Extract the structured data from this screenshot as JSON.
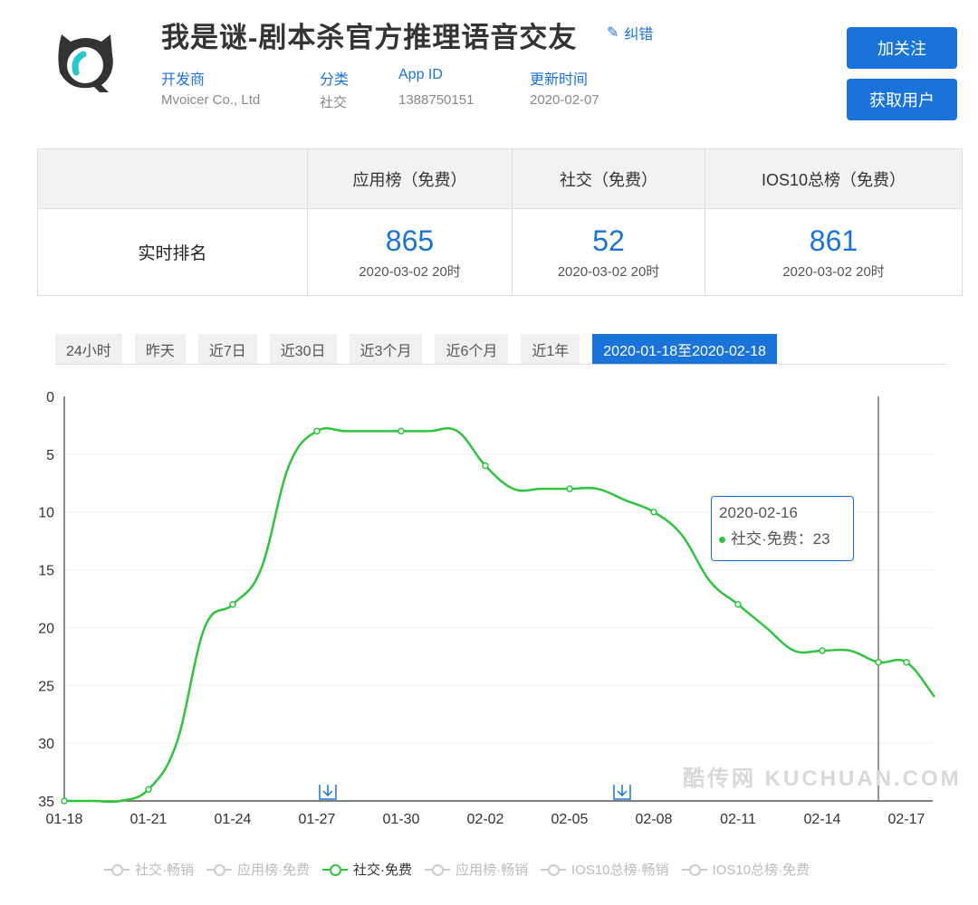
{
  "app": {
    "title": "我是谜-剧本杀官方推理语音交友",
    "fix_label": "纠错",
    "meta": [
      {
        "label": "开发商",
        "value": "Mvoicer Co., Ltd"
      },
      {
        "label": "分类",
        "value": "社交"
      },
      {
        "label": "App ID",
        "value": "1388750151"
      },
      {
        "label": "更新时间",
        "value": "2020-02-07"
      }
    ],
    "follow_label": "加关注",
    "get_users_label": "获取用户"
  },
  "rank_table": {
    "row_label": "实时排名",
    "columns": [
      {
        "header": "应用榜（免费）",
        "rank": "865",
        "time": "2020-03-02 20时"
      },
      {
        "header": "社交（免费）",
        "rank": "52",
        "time": "2020-03-02 20时"
      },
      {
        "header": "IOS10总榜（免费）",
        "rank": "861",
        "time": "2020-03-02 20时"
      }
    ]
  },
  "tabs": [
    "24小时",
    "昨天",
    "近7日",
    "近30日",
    "近3个月",
    "近6个月",
    "近1年",
    "2020-01-18至2020-02-18"
  ],
  "active_tab": 7,
  "colors": {
    "accent": "#1a73d9",
    "series": "#2ec43e"
  },
  "watermark": "酷传网 KUCHUAN.COM",
  "tooltip": {
    "date": "2020-02-16",
    "series": "社交·免费：",
    "value": "23"
  },
  "chart_data": {
    "type": "line",
    "ylim": [
      0,
      35
    ],
    "y_inverted": true,
    "yticks": [
      0,
      5,
      10,
      15,
      20,
      25,
      30,
      35
    ],
    "xticks": [
      "01-18",
      "01-21",
      "01-24",
      "01-27",
      "01-30",
      "02-02",
      "02-05",
      "02-08",
      "02-11",
      "02-14",
      "02-17"
    ],
    "x": [
      "01-18",
      "01-19",
      "01-20",
      "01-21",
      "01-22",
      "01-23",
      "01-24",
      "01-25",
      "01-26",
      "01-27",
      "01-28",
      "01-29",
      "01-30",
      "01-31",
      "02-01",
      "02-02",
      "02-03",
      "02-04",
      "02-05",
      "02-06",
      "02-07",
      "02-08",
      "02-09",
      "02-10",
      "02-11",
      "02-12",
      "02-13",
      "02-14",
      "02-15",
      "02-16",
      "02-17",
      "02-18"
    ],
    "series": [
      {
        "name": "社交·免费",
        "values": [
          35,
          35,
          35,
          34,
          30,
          20,
          18,
          15,
          6,
          3,
          3,
          3,
          3,
          3,
          3,
          6,
          8,
          8,
          8,
          8,
          9,
          10,
          12,
          16,
          18,
          20,
          22,
          22,
          22,
          23,
          23,
          26
        ]
      }
    ],
    "legend": [
      "社交·畅销",
      "应用榜·免费",
      "社交·免费",
      "应用榜·畅销",
      "IOS10总榜·畅销",
      "IOS10总榜·免费"
    ],
    "legend_active": 2,
    "legend_position": "bottom",
    "markers": [
      "01-27",
      "02-07"
    ],
    "highlight": "02-16"
  }
}
